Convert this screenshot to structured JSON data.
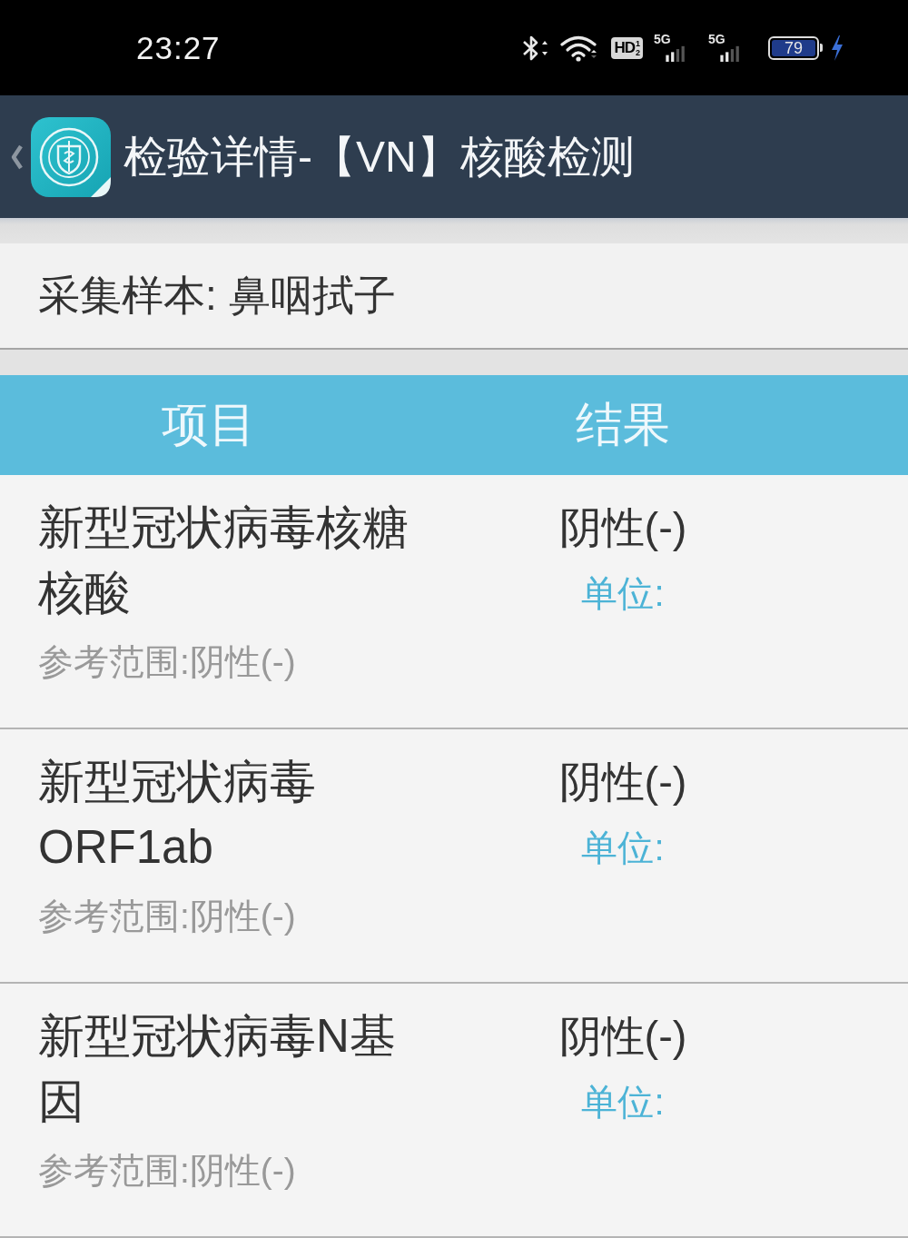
{
  "status_bar": {
    "time": "23:27",
    "hd_badge": {
      "label": "HD",
      "slots": [
        "1",
        "2"
      ]
    },
    "signals": [
      {
        "label": "5G"
      },
      {
        "label": "5G"
      }
    ],
    "battery": {
      "reading": "79",
      "charging": true
    }
  },
  "header": {
    "title": "检验详情-【VN】核酸检测"
  },
  "sample": {
    "text": "采集样本: 鼻咽拭子"
  },
  "table": {
    "columns": [
      "项目",
      "结果"
    ],
    "rows": [
      {
        "item": "新型冠状病毒核糖核酸",
        "reference": "参考范围:阴性(-)",
        "result": "阴性(-)",
        "unit": "单位:"
      },
      {
        "item": "新型冠状病毒ORF1ab",
        "reference": "参考范围:阴性(-)",
        "result": "阴性(-)",
        "unit": "单位:"
      },
      {
        "item": "新型冠状病毒N基因",
        "reference": "参考范围:阴性(-)",
        "result": "阴性(-)",
        "unit": "单位:"
      }
    ]
  }
}
